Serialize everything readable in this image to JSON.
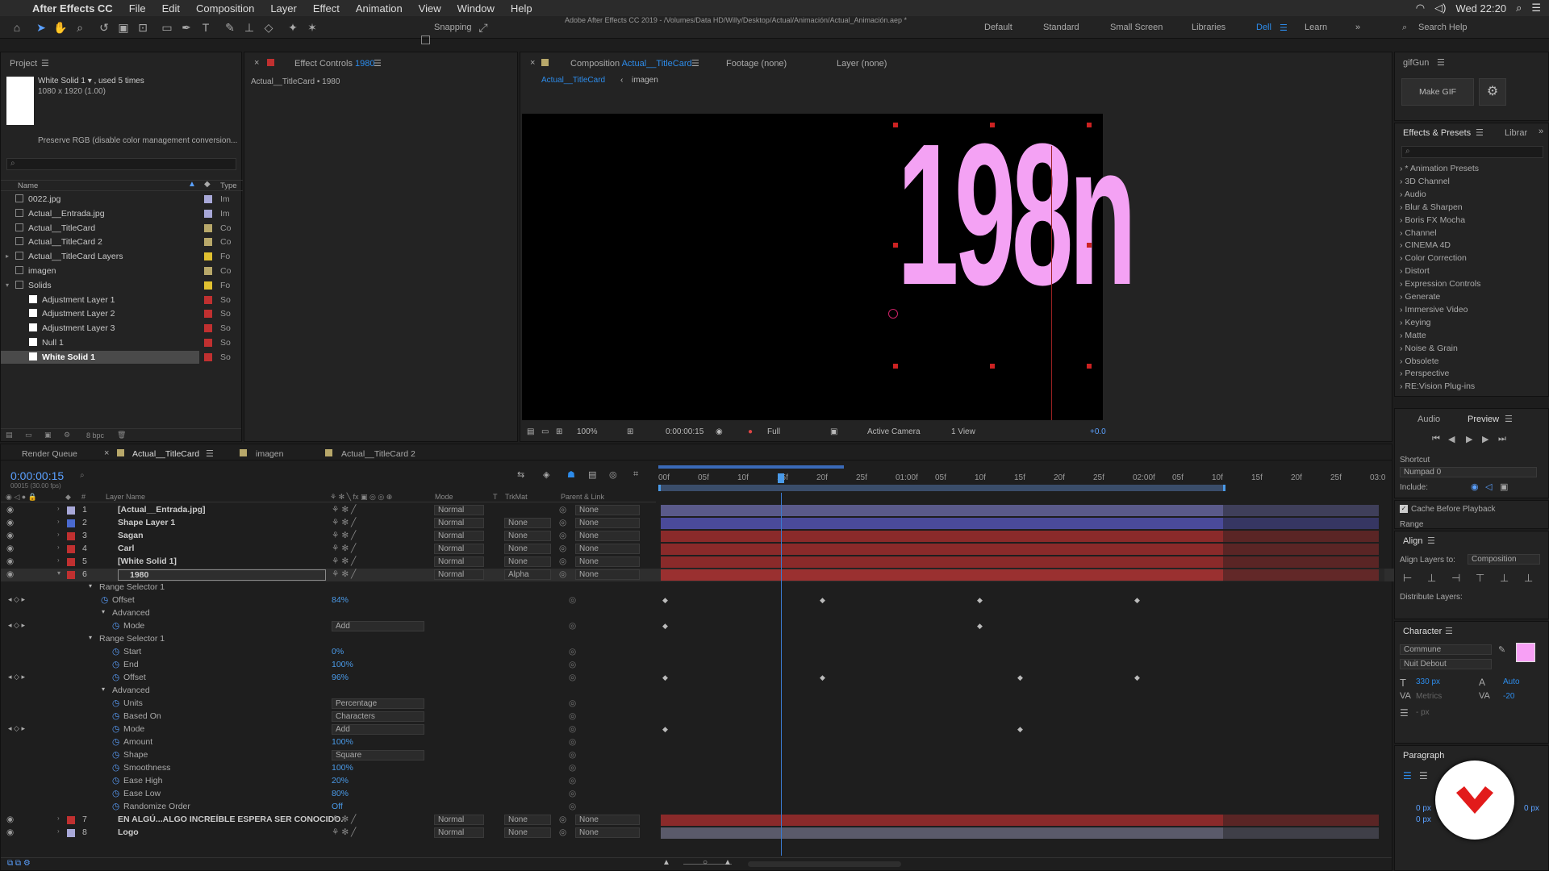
{
  "menubar": {
    "app": "After Effects CC",
    "items": [
      "File",
      "Edit",
      "Composition",
      "Layer",
      "Effect",
      "Animation",
      "View",
      "Window",
      "Help"
    ],
    "clock": "Wed 22:20"
  },
  "window_title": "Adobe After Effects CC 2019 - /Volumes/Data HD/Willy/Desktop/Actual/Animación/Actual_Animación.aep *",
  "toolbar": {
    "snapping": "Snapping",
    "workspaces": [
      "Default",
      "Standard",
      "Small Screen",
      "Libraries",
      "Dell",
      "Learn"
    ],
    "active_workspace": "Dell",
    "search_help": "Search Help"
  },
  "project": {
    "tab": "Project",
    "item_name": "White Solid 1 ▾ , used 5 times",
    "item_size": "1080 x 1920 (1.00)",
    "preserve": "Preserve RGB (disable color management conversion...",
    "col_name": "Name",
    "col_type": "Type",
    "bpc": "8 bpc",
    "items": [
      {
        "name": "0022.jpg",
        "type": "Im",
        "color": "#a8a8d8",
        "indent": 0
      },
      {
        "name": "Actual__Entrada.jpg",
        "type": "Im",
        "color": "#a8a8d8",
        "indent": 0
      },
      {
        "name": "Actual__TitleCard",
        "type": "Co",
        "color": "#b8a86a",
        "indent": 0
      },
      {
        "name": "Actual__TitleCard 2",
        "type": "Co",
        "color": "#b8a86a",
        "indent": 0
      },
      {
        "name": "Actual__TitleCard Layers",
        "type": "Fo",
        "color": "#e0c030",
        "indent": 0
      },
      {
        "name": "imagen",
        "type": "Co",
        "color": "#b8a86a",
        "indent": 0
      },
      {
        "name": "Solids",
        "type": "Fo",
        "color": "#e0c030",
        "indent": 0
      },
      {
        "name": "Adjustment Layer 1",
        "type": "So",
        "color": "#c03030",
        "indent": 1
      },
      {
        "name": "Adjustment Layer 2",
        "type": "So",
        "color": "#c03030",
        "indent": 1
      },
      {
        "name": "Adjustment Layer 3",
        "type": "So",
        "color": "#c03030",
        "indent": 1
      },
      {
        "name": "Null 1",
        "type": "So",
        "color": "#c03030",
        "indent": 1
      },
      {
        "name": "White Solid 1",
        "type": "So",
        "color": "#c03030",
        "indent": 1
      }
    ]
  },
  "effect_controls": {
    "tab": "Effect Controls",
    "tab_value": "1980",
    "subtitle": "Actual__TitleCard • 1980"
  },
  "viewer": {
    "comp_tab": "Composition",
    "comp_name": "Actual__TitleCard",
    "footage": "Footage (none)",
    "layer": "Layer (none)",
    "crumb1": "Actual__TitleCard",
    "crumb2": "imagen",
    "text": "198n",
    "zoom": "100%",
    "time": "0:00:00:15",
    "res": "Full",
    "camera": "Active Camera",
    "views": "1 View",
    "exposure": "+0.0"
  },
  "gifgun": {
    "tab": "gifGun",
    "make": "Make GIF"
  },
  "effects": {
    "tab": "Effects & Presets",
    "tab2": "Librar",
    "items": [
      "* Animation Presets",
      "3D Channel",
      "Audio",
      "Blur & Sharpen",
      "Boris FX Mocha",
      "Channel",
      "CINEMA 4D",
      "Color Correction",
      "Distort",
      "Expression Controls",
      "Generate",
      "Immersive Video",
      "Keying",
      "Matte",
      "Noise & Grain",
      "Obsolete",
      "Perspective",
      "RE:Vision Plug-ins"
    ]
  },
  "preview": {
    "audio": "Audio",
    "tab": "Preview",
    "shortcut_label": "Shortcut",
    "shortcut": "Numpad 0",
    "include": "Include:",
    "cache": "Cache Before Playback",
    "range": "Range"
  },
  "align": {
    "tab": "Align",
    "to_label": "Align Layers to:",
    "to": "Composition",
    "dist": "Distribute Layers:"
  },
  "character": {
    "tab": "Character",
    "font": "Commune",
    "style": "Nuit Debout",
    "size": "330 px",
    "leading": "Auto",
    "metrics": "Metrics",
    "tracking": "-20",
    "unit": "- px",
    "fill": "#f7a0f5"
  },
  "paragraph": {
    "tab": "Paragraph",
    "indent1": "0 px",
    "indent2": "0 px",
    "indent3": "0 px"
  },
  "timeline": {
    "tabs": [
      "Render Queue",
      "Actual__TitleCard",
      "imagen",
      "Actual__TitleCard 2"
    ],
    "timecode": "0:00:00:15",
    "fps": "00015 (30.00 fps)",
    "headers": {
      "num": "#",
      "name": "Layer Name",
      "mode": "Mode",
      "t": "T",
      "trkmat": "TrkMat",
      "parent": "Parent & Link"
    },
    "ruler": [
      "00f",
      "05f",
      "10f",
      "15f",
      "20f",
      "25f",
      "01:00f",
      "05f",
      "10f",
      "15f",
      "20f",
      "25f",
      "02:00f",
      "05f",
      "10f",
      "15f",
      "20f",
      "25f",
      "03:0"
    ],
    "layers": [
      {
        "num": "1",
        "name": "[Actual__Entrada.jpg]",
        "color": "#a8a8d8",
        "mode": "Normal",
        "trk": "",
        "parent": "None",
        "bar": "#5a5a8a"
      },
      {
        "num": "2",
        "name": "Shape Layer 1",
        "color": "#4a6ad0",
        "mode": "Normal",
        "trk": "None",
        "parent": "None",
        "bar": "#4a4a9a"
      },
      {
        "num": "3",
        "name": "Sagan",
        "color": "#c03030",
        "mode": "Normal",
        "trk": "None",
        "parent": "None",
        "bar": "#8a2a2a"
      },
      {
        "num": "4",
        "name": "Carl",
        "color": "#c03030",
        "mode": "Normal",
        "trk": "None",
        "parent": "None",
        "bar": "#8a2a2a"
      },
      {
        "num": "5",
        "name": "[White Solid 1]",
        "color": "#c03030",
        "mode": "Normal",
        "trk": "None",
        "parent": "None",
        "bar": "#8a2a2a"
      },
      {
        "num": "6",
        "name": "1980",
        "color": "#c03030",
        "mode": "Normal",
        "trk": "Alpha",
        "parent": "None",
        "bar": "#9a3030"
      }
    ],
    "props": [
      {
        "label": "Range Selector 1",
        "value": "",
        "level": 1
      },
      {
        "label": "Offset",
        "value": "84%",
        "level": 2
      },
      {
        "label": "Advanced",
        "value": "",
        "level": 2
      },
      {
        "label": "Mode",
        "value": "Add",
        "level": 3
      },
      {
        "label": "Range Selector 1",
        "value": "",
        "level": 1
      },
      {
        "label": "Start",
        "value": "0%",
        "level": 3
      },
      {
        "label": "End",
        "value": "100%",
        "level": 3
      },
      {
        "label": "Offset",
        "value": "96%",
        "level": 3
      },
      {
        "label": "Advanced",
        "value": "",
        "level": 2
      },
      {
        "label": "Units",
        "value": "Percentage",
        "level": 3
      },
      {
        "label": "Based On",
        "value": "Characters",
        "level": 3
      },
      {
        "label": "Mode",
        "value": "Add",
        "level": 3
      },
      {
        "label": "Amount",
        "value": "100%",
        "level": 3
      },
      {
        "label": "Shape",
        "value": "Square",
        "level": 3
      },
      {
        "label": "Smoothness",
        "value": "100%",
        "level": 3
      },
      {
        "label": "Ease High",
        "value": "20%",
        "level": 3
      },
      {
        "label": "Ease Low",
        "value": "80%",
        "level": 3
      },
      {
        "label": "Randomize Order",
        "value": "Off",
        "level": 3
      }
    ],
    "bottom_layers": [
      {
        "num": "7",
        "name": "EN ALGÚ...ALGO INCREÍBLE ESPERA SER CONOCIDO.",
        "color": "#c03030",
        "mode": "Normal",
        "trk": "None",
        "parent": "None",
        "bar": "#8a2a2a"
      },
      {
        "num": "8",
        "name": "Logo",
        "color": "#a8a8d8",
        "mode": "Normal",
        "trk": "None",
        "parent": "None",
        "bar": "#5a5a6a"
      }
    ]
  }
}
